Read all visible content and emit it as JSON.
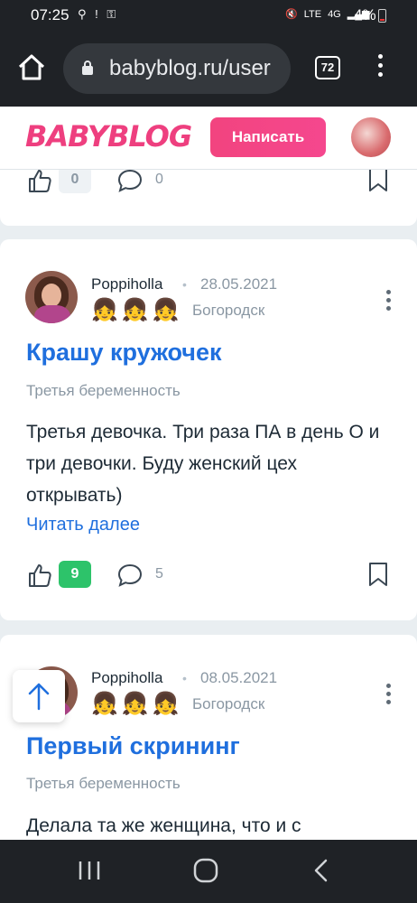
{
  "status": {
    "time": "07:25",
    "battery": "4%",
    "network": "4G"
  },
  "browser": {
    "url": "babyblog.ru/user",
    "tab_count": "72"
  },
  "header": {
    "logo": "BABYBLOG",
    "write_button": "Написать"
  },
  "feed": [
    {
      "likes": "0",
      "comments": "0"
    },
    {
      "author": "Poppiholla",
      "date": "28.05.2021",
      "badges": "👧👧👧",
      "city": "Богородск",
      "title": "Крашу кружочек",
      "category": "Третья беременность",
      "text": "Третья девочка. Три раза ПА в день О и три девочки. Буду женский цех открывать)",
      "read_more": "Читать далее",
      "likes": "9",
      "comments": "5"
    },
    {
      "author": "Poppiholla",
      "date": "08.05.2021",
      "badges": "👧👧👧",
      "city": "Богородск",
      "title": "Первый скрининг",
      "category": "Третья беременность",
      "text": "Делала та же женщина, что и с"
    }
  ],
  "colors": {
    "accent_blue": "#1f6fde",
    "brand_pink": "#ee3f7f",
    "like_green": "#2dc36a"
  }
}
